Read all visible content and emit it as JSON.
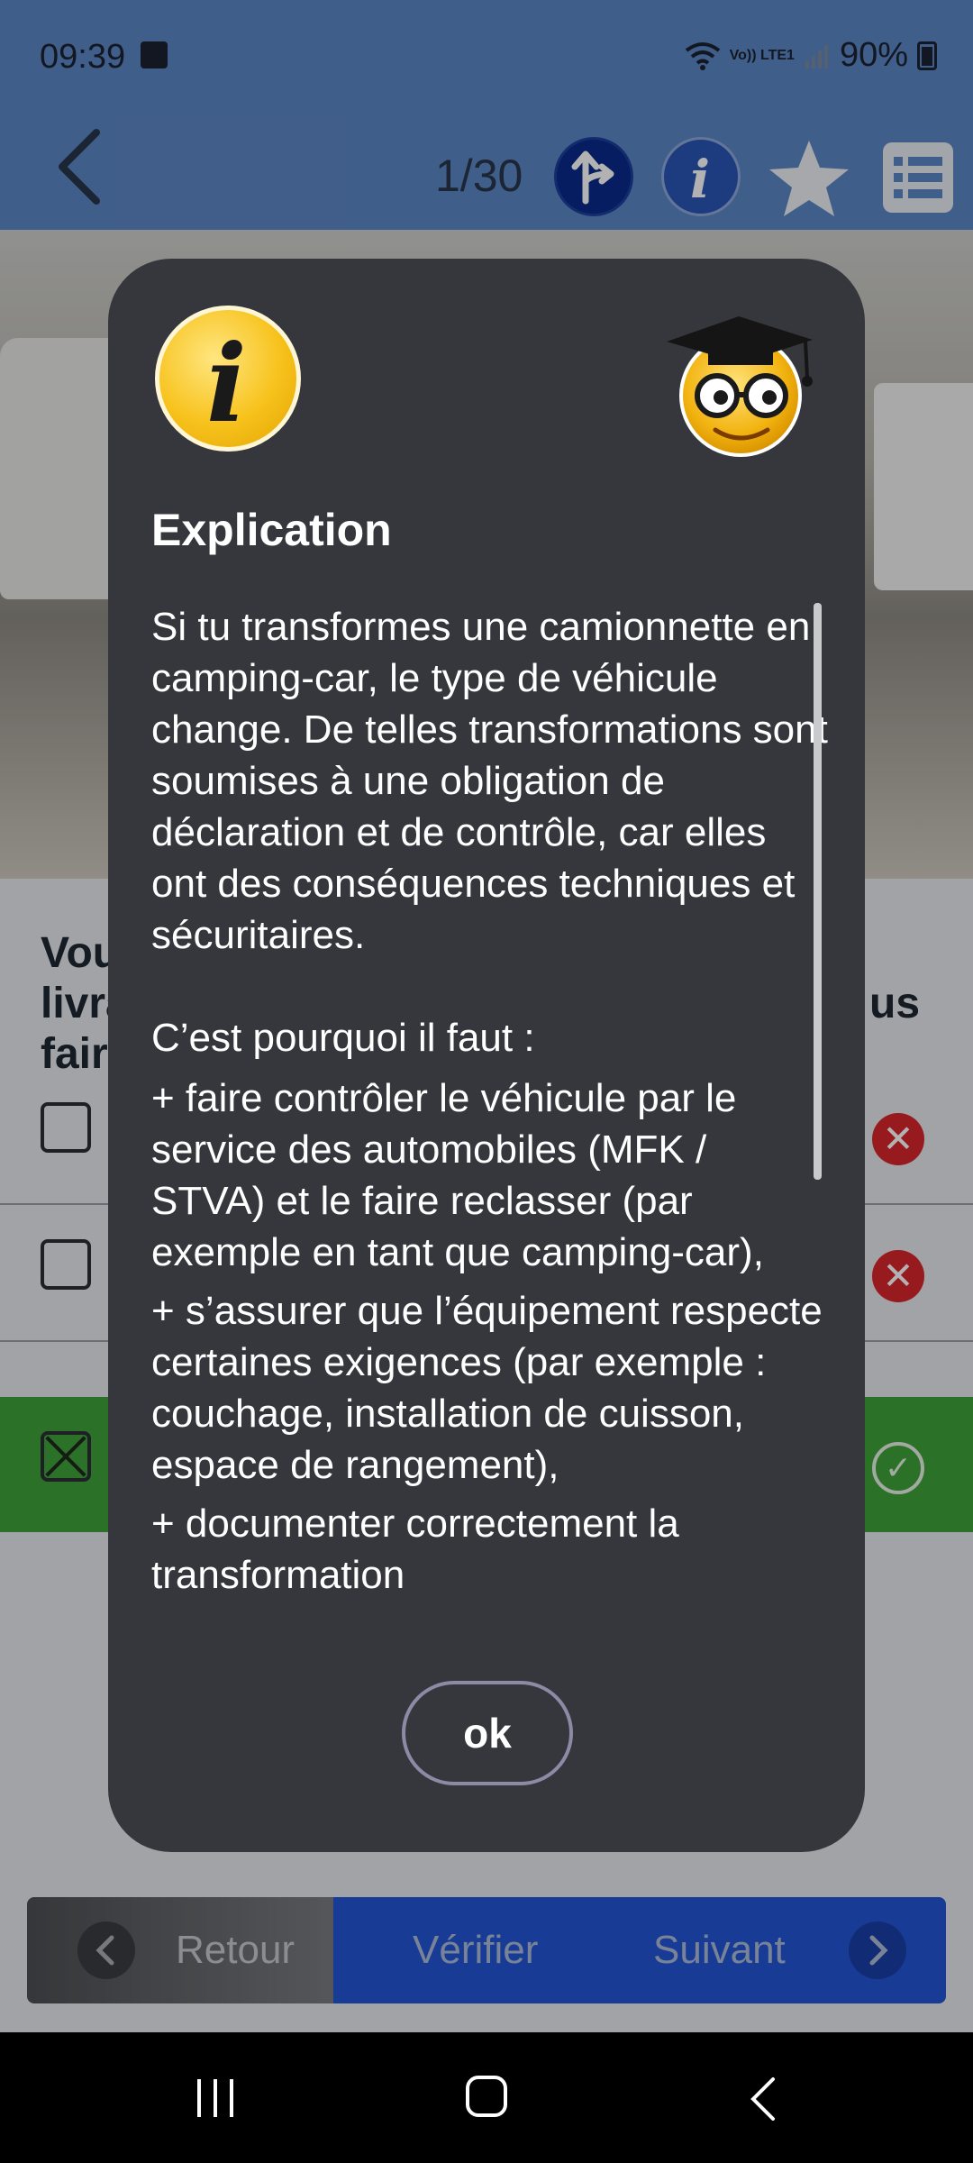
{
  "status_bar": {
    "time": "09:39",
    "network": "Vo)) LTE1",
    "battery": "90%"
  },
  "toolbar": {
    "counter": "1/30"
  },
  "question": {
    "lines_visible": [
      "Vou",
      "livra",
      "fair"
    ],
    "right_fragment": "us"
  },
  "answers": [
    {
      "checked": false,
      "result": "wrong"
    },
    {
      "checked": false,
      "result": "wrong"
    },
    {
      "checked": true,
      "result": "correct"
    }
  ],
  "bottom_nav": {
    "back_label": "Retour",
    "verify_label": "Vérifier",
    "next_label": "Suivant"
  },
  "dialog": {
    "title": "Explication",
    "paragraph1": "Si tu transformes une camionnette en camping-car, le type de véhicule change. De telles transformations sont soumises à une obligation de déclaration et de contrôle, car elles ont des conséquences techniques et sécuritaires.",
    "paragraph2": "C’est pourquoi il faut :",
    "items": [
      "+ faire contrôler le véhicule par le service des automobiles (MFK / STVA) et le faire reclasser (par exemple en tant que camping-car),",
      "+ s’assurer que l’équipement respecte certaines exigences (par exemple : couchage, installation de cuisson, espace de rangement),",
      "+ documenter correctement la transformation"
    ],
    "ok_label": "ok"
  },
  "colors": {
    "header_blue": "#5b87c4",
    "dialog_bg": "#36373c",
    "correct_green": "#3ea23a",
    "wrong_red": "#d8262b",
    "nav_blue": "#2356d6"
  }
}
